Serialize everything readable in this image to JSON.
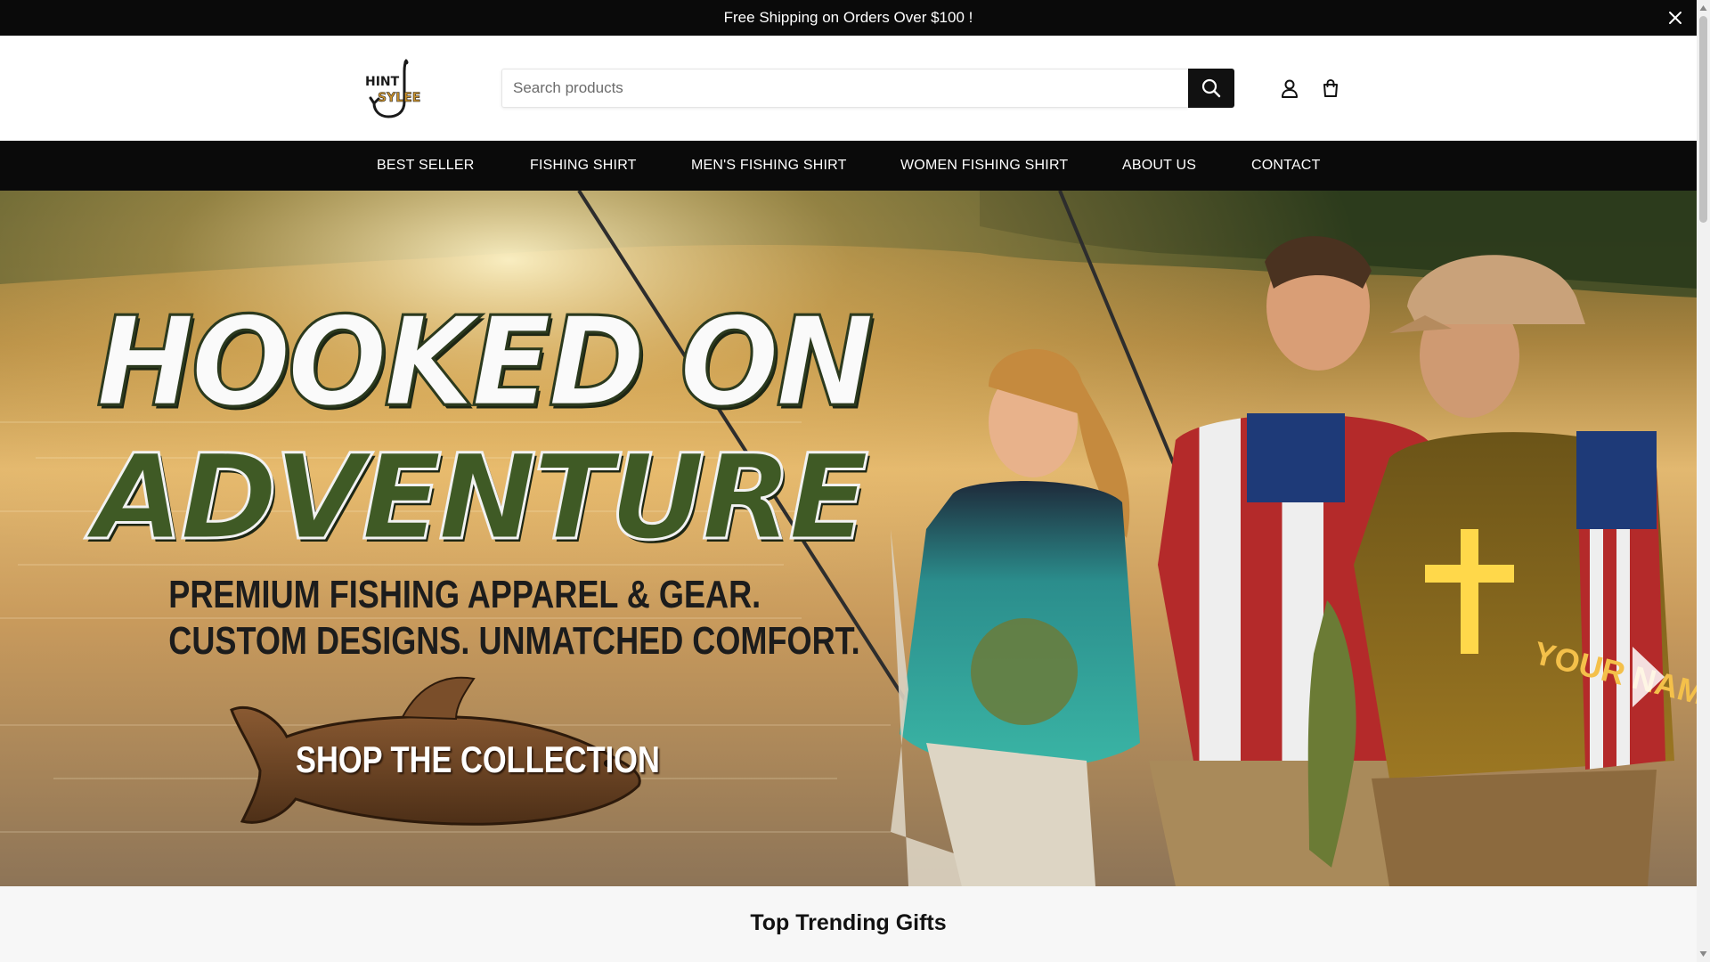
{
  "announcement": {
    "text": "Free Shipping on Orders Over $100 !"
  },
  "header": {
    "logo_text": [
      "HINT",
      "SYLEE"
    ],
    "search_placeholder": "Search products"
  },
  "nav": {
    "items": [
      {
        "label": "BEST SELLER"
      },
      {
        "label": "FISHING SHIRT"
      },
      {
        "label": "MEN'S FISHING SHIRT"
      },
      {
        "label": "WOMEN FISHING SHIRT"
      },
      {
        "label": "ABOUT US"
      },
      {
        "label": "CONTACT"
      }
    ]
  },
  "hero": {
    "headline_line1": "HOOKED ON",
    "headline_line2": "ADVENTURE",
    "subline1": "PREMIUM FISHING APPAREL & GEAR.",
    "subline2": "CUSTOM DESIGNS. UNMATCHED COMFORT.",
    "cta_label": "SHOP THE COLLECTION",
    "shirt_text": "YOUR NAME"
  },
  "section": {
    "title": "Top Trending Gifts"
  },
  "colors": {
    "bar": "#0a0a0a",
    "accent_green": "#3f5a25",
    "sun": "#f5c267"
  },
  "icons": [
    "close-icon",
    "search-icon",
    "user-icon",
    "cart-icon",
    "chevron-right-icon"
  ]
}
